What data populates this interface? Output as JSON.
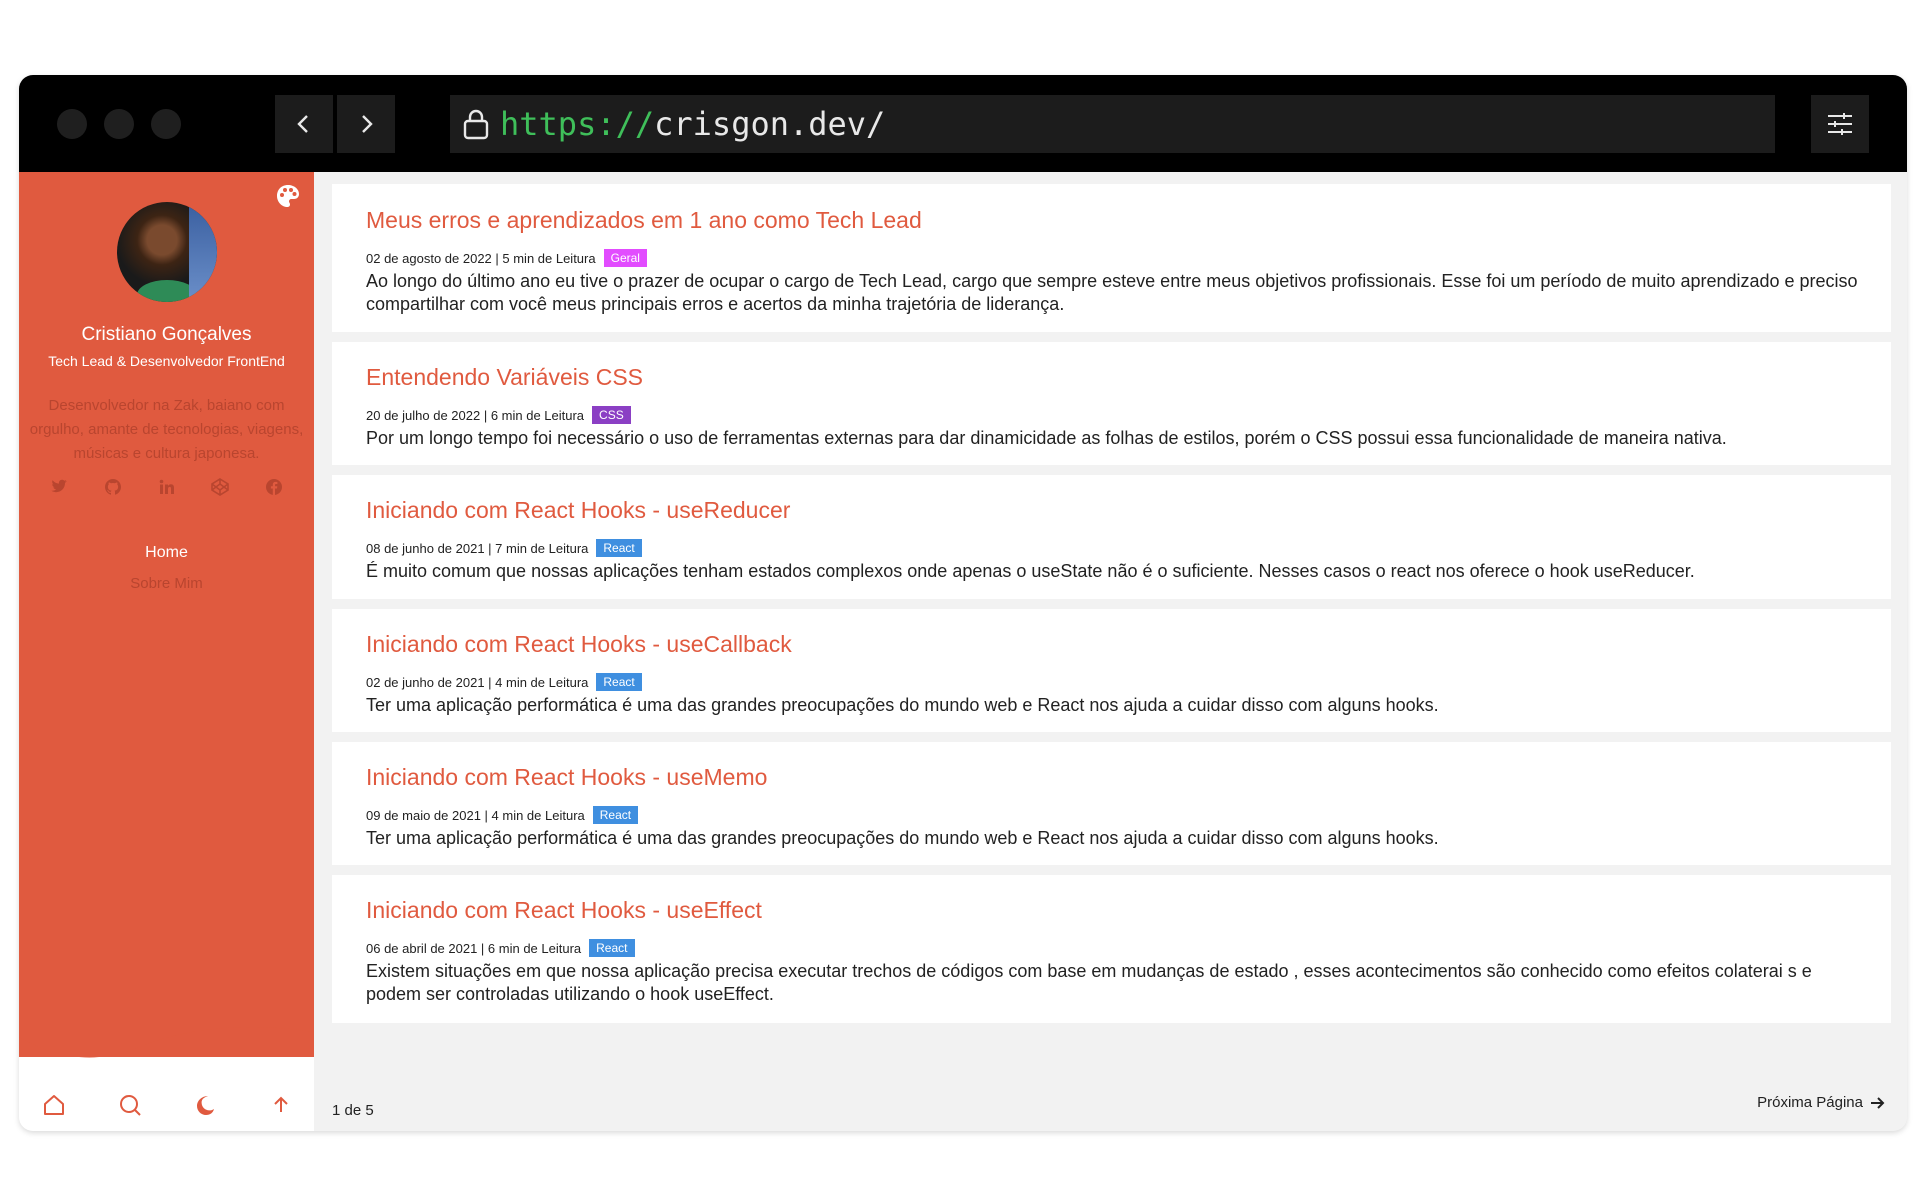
{
  "browser": {
    "url_scheme": "https://",
    "url_host": "crisgon.dev/"
  },
  "sidebar": {
    "author_name": "Cristiano Gonçalves",
    "author_role": "Tech Lead & Desenvolvedor FrontEnd",
    "author_bio": "Desenvolvedor na Zak, baiano com orgulho, amante de tecnologias, viagens, músicas e cultura japonesa.",
    "socials": [
      "twitter-icon",
      "github-icon",
      "linkedin-icon",
      "codepen-icon",
      "facebook-icon"
    ],
    "nav": [
      {
        "label": "Home"
      },
      {
        "label": "Sobre Mim"
      }
    ],
    "bottom_icons": [
      "home-icon",
      "search-icon",
      "moon-icon",
      "arrow-up-icon"
    ]
  },
  "posts": [
    {
      "title": "Meus erros e aprendizados em 1 ano como Tech Lead",
      "meta": "02 de agosto de 2022 | 5 min de Leitura",
      "tag": "Geral",
      "tag_color": "#e24cff",
      "description": "Ao longo do último ano eu tive o prazer de ocupar o cargo de Tech Lead, cargo que sempre esteve entre meus objetivos profissionais. Esse foi um período de muito aprendizado e preciso compartilhar com você meus principais erros e acertos da minha trajetória de liderança."
    },
    {
      "title": "Entendendo Variáveis CSS",
      "meta": "20 de julho de 2022 | 6 min de Leitura",
      "tag": "CSS",
      "tag_color": "#8b3fc4",
      "description": "Por um longo tempo foi necessário o uso de ferramentas externas para dar dinamicidade as folhas de estilos, porém o CSS possui essa funcionalidade de maneira nativa."
    },
    {
      "title": "Iniciando com React Hooks - useReducer",
      "meta": "08 de junho de 2021 | 7 min de Leitura",
      "tag": "React",
      "tag_color": "#3f8fe0",
      "description": "É muito comum que nossas aplicações tenham estados complexos onde apenas o useState não é o suficiente. Nesses casos o react nos oferece o hook useReducer."
    },
    {
      "title": "Iniciando com React Hooks - useCallback",
      "meta": "02 de junho de 2021 | 4 min de Leitura",
      "tag": "React",
      "tag_color": "#3f8fe0",
      "description": "Ter uma aplicação performática é uma das grandes preocupações do mundo web e React nos ajuda a cuidar disso com alguns hooks."
    },
    {
      "title": "Iniciando com React Hooks - useMemo",
      "meta": "09 de maio de 2021 | 4 min de Leitura",
      "tag": "React",
      "tag_color": "#3f8fe0",
      "description": "Ter uma aplicação performática é uma das grandes preocupações do mundo web e React nos ajuda a cuidar disso com alguns hooks."
    },
    {
      "title": "Iniciando com React Hooks - useEffect",
      "meta": "06 de abril de 2021 | 6 min de Leitura",
      "tag": "React",
      "tag_color": "#3f8fe0",
      "description": "Existem situações em que nossa aplicação precisa executar trechos de códigos com base em mudanças de estado , esses acontecimentos são conhecido como efeitos colaterai s e podem ser controladas utilizando o hook useEffect."
    }
  ],
  "pagination": {
    "count": "1 de 5",
    "next_label": "Próxima Página"
  },
  "colors": {
    "accent": "#e05a3f",
    "url_scheme": "#3fbf5a"
  }
}
